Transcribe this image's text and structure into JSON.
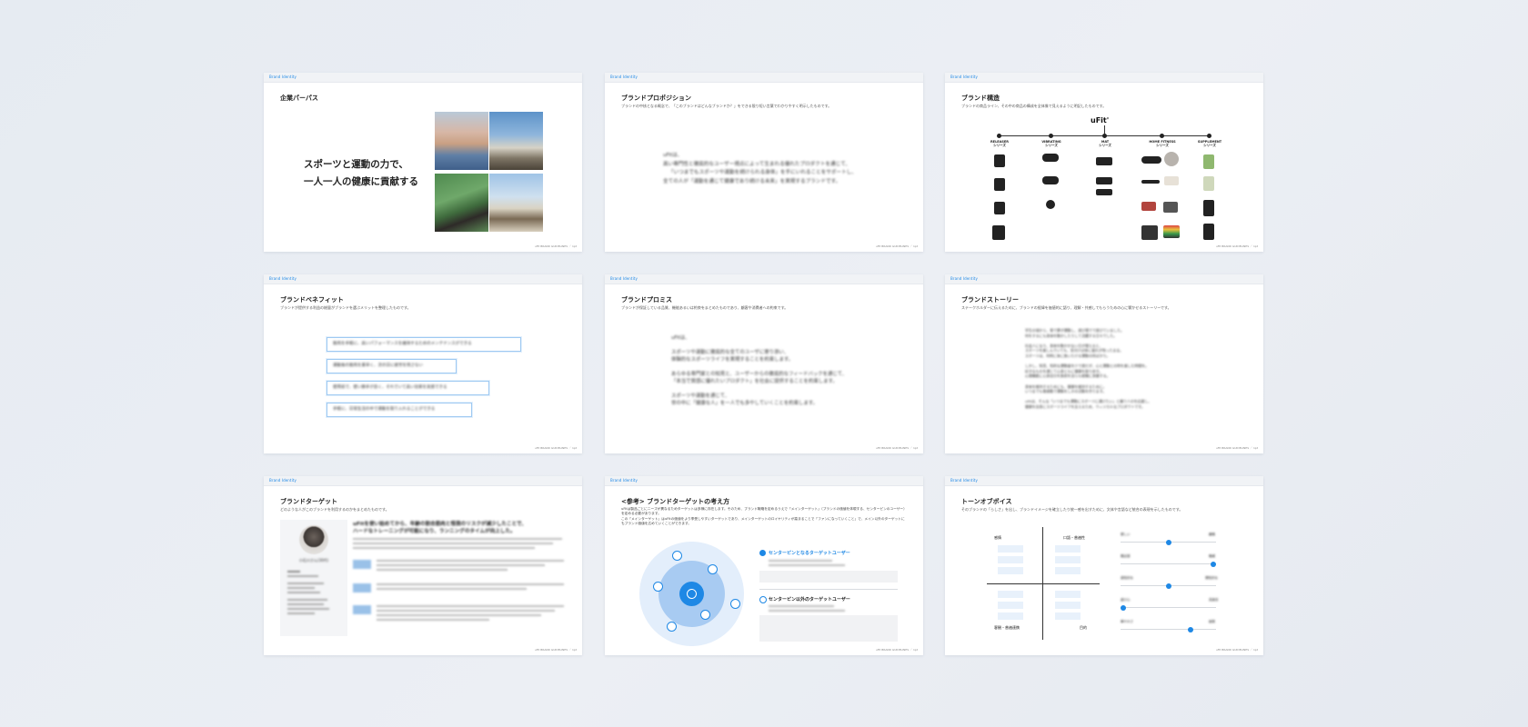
{
  "common": {
    "tag": "Brand Identity",
    "footer": "uFit BRAND GUIDELINES ／ 1pt"
  },
  "slides": [
    {
      "title": "企業パーパス",
      "hero_line1": "スポーツと運動の力で、",
      "hero_line2": "一人一人の健康に貢献する"
    },
    {
      "title": "ブランドプロポジション",
      "subtitle": "ブランドの中核となる概念で、「このブランドはどんなブランドか？」をできる限り短い言葉でわかりやすく明示したものです。",
      "body": [
        "uFitは、",
        "高い専門性と徹底的なユーザー視点によって生まれる優れたプロダクトを通じて、",
        "「いつまでもスポーツや運動を続けられる身体」を手にいれることをサポートし、",
        "全ての人が「運動を通じて健康であり続ける未来」を実現するブランドです。"
      ]
    },
    {
      "title": "ブランド構造",
      "subtitle": "ブランドの商品ライン、その中の商品の構成を全体像で見えるように明記したものです。",
      "brand": "uFit'",
      "categories": [
        {
          "name": "RELEASER",
          "suffix": "シリーズ"
        },
        {
          "name": "VIBRATING",
          "suffix": "シリーズ"
        },
        {
          "name": "MAT",
          "suffix": "シリーズ"
        },
        {
          "name": "HOME FITNESS",
          "suffix": "シリーズ"
        },
        {
          "name": "SUPPLEMENT",
          "suffix": "シリーズ"
        }
      ]
    },
    {
      "title": "ブランドベネフィット",
      "subtitle": "ブランドが提供する利益の総量がブランドを選ぶメリットを整理したものです。",
      "items": [
        "筋肉を手軽に、高いパフォーマンスを維持するためのメンテナンスができる",
        "運動後の筋肉を素早く、次の日に疲労を残さない",
        "使用前で、使い勝手が良く、それでいて高い効果を実感できる",
        "手軽に、日常生活の中で運動を取り入れることができる"
      ]
    },
    {
      "title": "ブランドプロミス",
      "subtitle": "ブランドが保証している品質、機能あるいは約束をまとめたものであり、顧客や消費者への約束です。",
      "body": [
        "uFitは、",
        "",
        "スポーツや運動に徹底的な全てのユーザに寄り添い、",
        "体験的なスポーツライフを実現することを約束します。",
        "",
        "あらゆる専門家との知見と、ユーザーからの徹底的なフィードバックを通じて、",
        "「本当で質感に優れたいプロダクト」を社会に提供することを約束します。",
        "",
        "スポーツや運動を通じて、",
        "世の中に「健康な人」を一人でも多やしていくことを約束します。"
      ]
    },
    {
      "title": "ブランドストーリー",
      "subtitle": "ステークホルダーに伝えるために、ブランドの経緯を価値的に語り、理解・共感してもらうための心に響かせるストーリーです。",
      "body": [
        "学生の頃から、骨で夢が運動し、遊び場でで遊びていました。",
        "何をするにも身体を動かしたりして活躍する日々でした。",
        "",
        "社会人になり、身体を動かかない日が増えると、",
        "スポーツを楽しんでいても、気付けば体に疲れが残ったまま。",
        "スポーツは、何時に体に負いたける運動の所ばかり。",
        "",
        "しかし、知見、知的な運動量を少で遊だが、心と運動との時を楽しむ時間を。",
        "好きなものを通じて心身ともに健康を取り戻す。",
        "心理機能に心身自分を負担を自らも経験に身健する。",
        "",
        "身体を維持するためにも、健康を維持するために。",
        "いつまでも質感動で運動をしかの活動を作ります。",
        "",
        "uFitは、そんな「いつまでも運動にスポーツに通けたい」と願う人のを応援し、",
        "健康を自身にスポーツライフを支えるため、ウィジカルなプロダクトです。"
      ]
    },
    {
      "title": "ブランドターゲット",
      "subtitle": "どのような人がこのブランドを利用するのかをまとめたものです。",
      "persona_name": "小石川さん(30代)",
      "headline": [
        "uFitを使い始めてから、年齢の割合筋肉と怪我のリスクが減少したことで、",
        "ハードなトレーニングが可能になり、ランニングのタイムが向上した。"
      ]
    },
    {
      "title": "<参考> ブランドターゲットの考え方",
      "subtitle_lines": [
        "uFitは製品ごとにニーズが異なるためターゲットは多様に存在します。そのため、ブランド戦略を定めるうえで「メインターゲット」（ブランドの価値を体現する、センターピンのユーザー）を定める必要があります。",
        "この「メインターゲット」はuFitの価値をより享受しやすいターゲットであり、メインターゲットのロイヤリティが高まることで「ファンになっていくこと」で、メイン以外のターゲットにもブランド価値を広めていくことができます。"
      ],
      "legend_main": "センターピンとなるターゲットユーザー",
      "legend_other": "センターピン以外のターゲットユーザー"
    },
    {
      "title": "トーンオブボイス",
      "subtitle": "そのブランドの「らしさ」を出し、ブランドイメージを確立したり統一感を出すために、文体や言語など統合の表現を示したものです。",
      "quadrants": {
        "top_left": "感情",
        "top_right": "口語・普遍性",
        "bottom_left": "客観・普遍連携",
        "bottom_right": "目的"
      },
      "sliders": [
        {
          "left": "優しい",
          "right": "厳格",
          "value": 0.5
        },
        {
          "left": "親近感",
          "right": "権威",
          "value": 1.0
        },
        {
          "left": "感性的な",
          "right": "理性的な",
          "value": 0.5
        },
        {
          "left": "遊び心",
          "right": "真面目",
          "value": 0.0
        },
        {
          "left": "華やかさ",
          "right": "誠実",
          "value": 0.75
        }
      ]
    }
  ]
}
